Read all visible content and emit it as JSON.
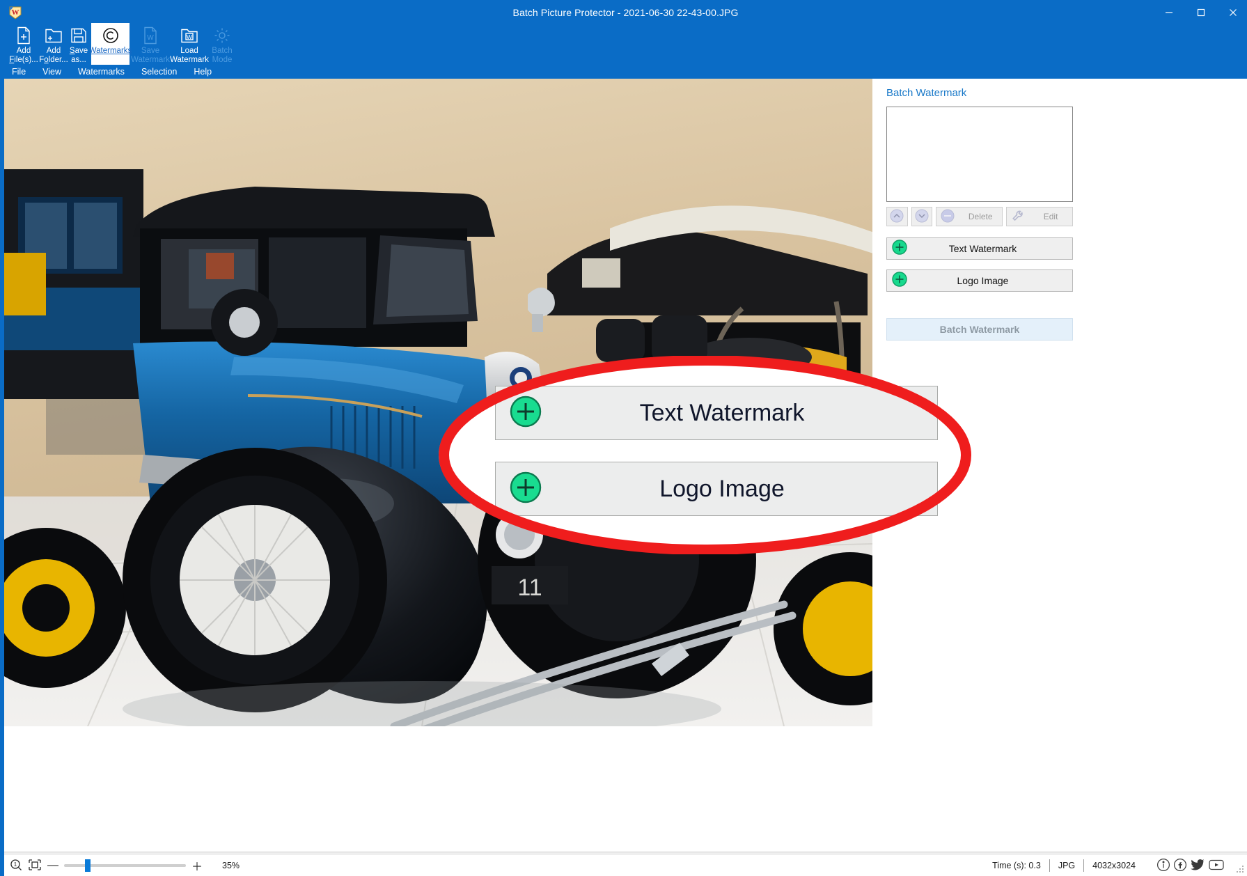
{
  "window": {
    "title": "Batch Picture Protector - 2021-06-30 22-43-00.JPG",
    "app_icon": "app-logo-icon",
    "controls": [
      {
        "name": "minimize-button",
        "glyph": "─"
      },
      {
        "name": "maximize-button",
        "glyph": "□"
      },
      {
        "name": "close-button",
        "glyph": "✕"
      }
    ]
  },
  "toolbar": {
    "items": [
      {
        "id": "add-files",
        "line1": "Add",
        "line2": "File(s)...",
        "icon": "file-plus-icon",
        "enabled": true,
        "active": false
      },
      {
        "id": "add-folder",
        "line1": "Add",
        "line2": "Folder...",
        "icon": "folder-plus-icon",
        "enabled": true,
        "active": false
      },
      {
        "id": "save-as",
        "line1": "Save",
        "line2": "as...",
        "icon": "floppy-disk-icon",
        "enabled": true,
        "active": false
      },
      {
        "id": "watermarks",
        "line1": "Watermarks",
        "line2": "",
        "icon": "copyright-icon",
        "enabled": true,
        "active": true
      },
      {
        "id": "save-watermark",
        "line1": "Save",
        "line2": "Watermark",
        "icon": "w-file-icon",
        "enabled": false,
        "active": false
      },
      {
        "id": "load-watermark",
        "line1": "Load",
        "line2": "Watermark",
        "icon": "w-folder-icon",
        "enabled": true,
        "active": false
      },
      {
        "id": "batch-mode",
        "line1": "Batch",
        "line2": "Mode",
        "icon": "gear-icon",
        "enabled": false,
        "active": false
      }
    ]
  },
  "menubar": {
    "items": [
      {
        "id": "file",
        "label": "File"
      },
      {
        "id": "view",
        "label": "View"
      },
      {
        "id": "watermarks",
        "label": "Watermarks"
      },
      {
        "id": "selection",
        "label": "Selection"
      },
      {
        "id": "help",
        "label": "Help"
      }
    ]
  },
  "sidepanel": {
    "title": "Batch Watermark",
    "list_items": [],
    "small_buttons": [
      {
        "id": "move-up",
        "label": "",
        "icon": "chevron-up-circle-icon"
      },
      {
        "id": "move-down",
        "label": "",
        "icon": "chevron-down-circle-icon"
      },
      {
        "id": "delete",
        "label": "Delete",
        "icon": "minus-circle-icon"
      },
      {
        "id": "edit",
        "label": "Edit",
        "icon": "wrench-icon"
      }
    ],
    "add_buttons": [
      {
        "id": "text-watermark",
        "label": "Text Watermark",
        "icon": "plus-circle-icon"
      },
      {
        "id": "logo-image",
        "label": "Logo Image",
        "icon": "plus-circle-icon"
      }
    ],
    "batch_button": {
      "id": "batch-watermark",
      "label": "Batch Watermark",
      "enabled": false
    }
  },
  "callout": {
    "highlight_color": "#ef1d1d",
    "buttons": [
      {
        "id": "text-watermark-magnified",
        "label": "Text Watermark",
        "icon": "plus-circle-icon"
      },
      {
        "id": "logo-image-magnified",
        "label": "Logo Image",
        "icon": "plus-circle-icon"
      }
    ]
  },
  "statusbar": {
    "zoom_icon": "magnifier-one-icon",
    "fit_icon": "fit-to-window-icon",
    "minus": "—",
    "plus": "＋",
    "zoom_percent": "35%",
    "time_label": "Time (s): 0.3",
    "format": "JPG",
    "dimensions": "4032x3024",
    "social": [
      {
        "id": "info",
        "icon": "info-circle-icon"
      },
      {
        "id": "facebook",
        "icon": "facebook-icon"
      },
      {
        "id": "twitter",
        "icon": "twitter-bird-icon"
      },
      {
        "id": "youtube",
        "icon": "youtube-play-icon"
      }
    ]
  },
  "photo": {
    "description": "vintage-car-museum-photo",
    "accent_blue": "#1a6aa8",
    "wall": "#ddc9a8",
    "floor": "#e8e8e6"
  }
}
